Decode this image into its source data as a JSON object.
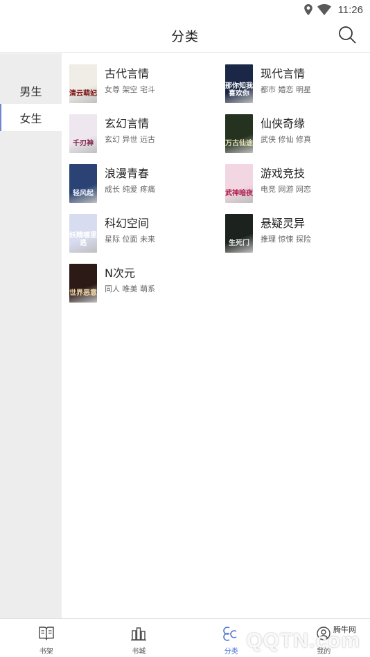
{
  "status_bar": {
    "time": "11:26",
    "icons": [
      "location-icon",
      "wifi-icon"
    ]
  },
  "header": {
    "title": "分类",
    "search_icon": "search-icon"
  },
  "sidebar": {
    "items": [
      {
        "label": "男生",
        "active": false
      },
      {
        "label": "女生",
        "active": true
      }
    ]
  },
  "categories": [
    {
      "name": "古代言情",
      "tags": "女尊 架空 宅斗",
      "cover_text": "清云萌妃",
      "cover_bg": "#f0ece6",
      "cover_fg": "#7a1010"
    },
    {
      "name": "现代言情",
      "tags": "都市 婚恋 明星",
      "cover_text": "那你知我喜欢你",
      "cover_bg": "#1b2746",
      "cover_fg": "#ffffff"
    },
    {
      "name": "玄幻言情",
      "tags": "玄幻 异世 远古",
      "cover_text": "千刃神",
      "cover_bg": "#efe7ef",
      "cover_fg": "#7d1d4a"
    },
    {
      "name": "仙侠奇缘",
      "tags": "武侠 修仙 修真",
      "cover_text": "万古仙途",
      "cover_bg": "#24321f",
      "cover_fg": "#e8e6b8"
    },
    {
      "name": "浪漫青春",
      "tags": "成长 纯爱 疼痛",
      "cover_text": "轻风起",
      "cover_bg": "#2a4374",
      "cover_fg": "#e9eef8"
    },
    {
      "name": "游戏竞技",
      "tags": "电竞 网游 网恋",
      "cover_text": "武神暗夜",
      "cover_bg": "#f2d6e2",
      "cover_fg": "#b1214d"
    },
    {
      "name": "科幻空间",
      "tags": "星际 位面 未来",
      "cover_text": "妖精哪里逃",
      "cover_bg": "#d8dcf0",
      "cover_fg": "#ffffff"
    },
    {
      "name": "悬疑灵异",
      "tags": "推理 惊悚 探险",
      "cover_text": "生死门",
      "cover_bg": "#1c231e",
      "cover_fg": "#e9e9e9"
    },
    {
      "name": "N次元",
      "tags": "同人 唯美 萌系",
      "cover_text": "世界恶意",
      "cover_bg": "#2b1a15",
      "cover_fg": "#f3d9a8"
    }
  ],
  "tabs": [
    {
      "label": "书架",
      "icon": "book-open-icon",
      "active": false
    },
    {
      "label": "书城",
      "icon": "bookstore-icon",
      "active": false
    },
    {
      "label": "分类",
      "icon": "category-icon",
      "active": true
    },
    {
      "label": "我的",
      "icon": "profile-icon",
      "active": false
    }
  ],
  "watermark": {
    "text": "QQTN.com",
    "small": "腾牛网"
  }
}
